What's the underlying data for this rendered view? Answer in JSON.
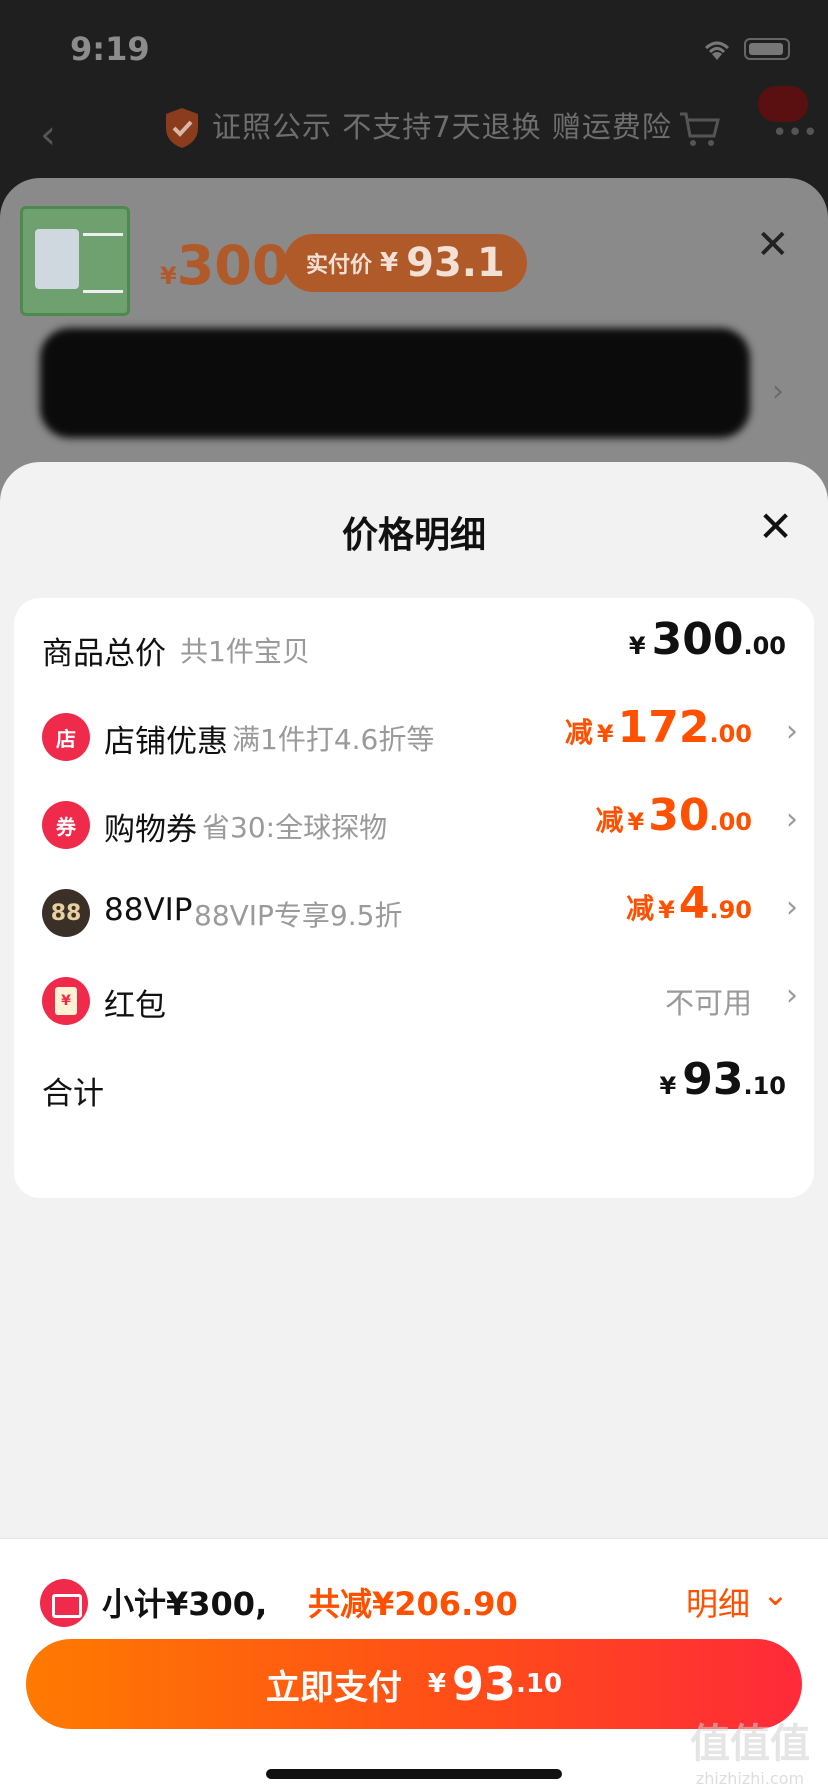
{
  "status_bar": {
    "time": "9:19"
  },
  "nav": {
    "back_icon": "‹",
    "notice": "证照公示 不支持7天退换 赠运费险",
    "more_icon": "•••"
  },
  "product": {
    "price_yen": "¥",
    "price": "300",
    "actual_label": "实付价",
    "actual_yen": "¥",
    "actual_price": "93.1",
    "close_icon": "✕",
    "chevron": "›"
  },
  "detail": {
    "title": "价格明细",
    "close_icon": "✕",
    "rows": {
      "total_goods": {
        "label": "商品总价",
        "sub": "共1件宝贝",
        "yen": "¥",
        "int": "300",
        "dec": ".00"
      },
      "store": {
        "icon": "店",
        "label": "店铺优惠",
        "sub": "满1件打4.6折等",
        "pre": "减",
        "yen": "¥",
        "int": "172",
        "dec": ".00",
        "chevron": "›"
      },
      "coupon": {
        "icon": "券",
        "label": "购物券",
        "sub": "省30:全球探物",
        "pre": "减",
        "yen": "¥",
        "int": "30",
        "dec": ".00",
        "chevron": "›"
      },
      "vip": {
        "icon": "88",
        "label": "88VIP",
        "sub": "88VIP专享9.5折",
        "pre": "减",
        "yen": "¥",
        "int": "4",
        "dec": ".90",
        "chevron": "›"
      },
      "redpacket": {
        "icon": "¥",
        "label": "红包",
        "status": "不可用",
        "chevron": "›"
      },
      "sum": {
        "label": "合计",
        "yen": "¥",
        "int": "93",
        "dec": ".10"
      }
    }
  },
  "bottom": {
    "subtotal": "小计¥300,",
    "saved": "共减¥206.90",
    "detail_link": "明细",
    "detail_chevron": "⌄",
    "pay_label": "立即支付",
    "pay_yen": "¥",
    "pay_int": "93",
    "pay_dec": ".10"
  },
  "watermark": {
    "line1": "值值值",
    "line2": "zhizhizhi.com"
  },
  "colors": {
    "accent": "#ff5000",
    "red": "#f02a4a",
    "vip": "#3a3028"
  }
}
